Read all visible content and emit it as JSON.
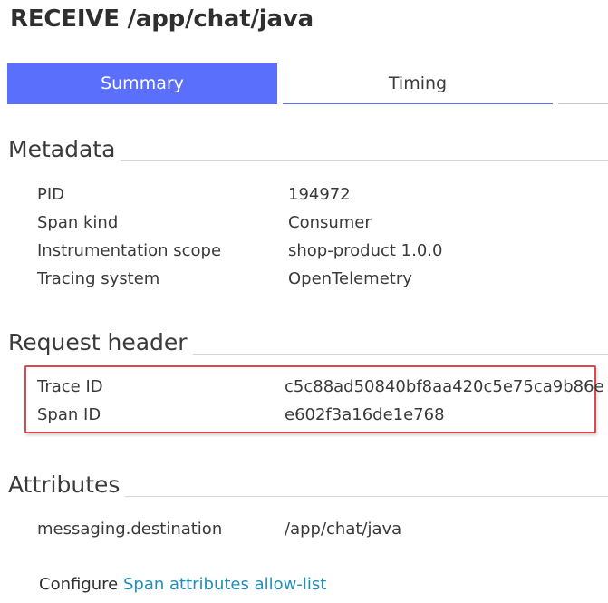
{
  "header": {
    "title": "RECEIVE /app/chat/java"
  },
  "tabs": [
    {
      "label": "Summary",
      "active": true
    },
    {
      "label": "Timing",
      "active": false
    }
  ],
  "sections": {
    "metadata": {
      "title": "Metadata",
      "rows": [
        {
          "key": "PID",
          "value": "194972"
        },
        {
          "key": "Span kind",
          "value": "Consumer"
        },
        {
          "key": "Instrumentation scope",
          "value": "shop-product 1.0.0"
        },
        {
          "key": "Tracing system",
          "value": "OpenTelemetry"
        }
      ]
    },
    "request_header": {
      "title": "Request header",
      "rows": [
        {
          "key": "Trace ID",
          "value": "c5c88ad50840bf8aa420c5e75ca9b86e"
        },
        {
          "key": "Span ID",
          "value": "e602f3a16de1e768"
        }
      ]
    },
    "attributes": {
      "title": "Attributes",
      "rows": [
        {
          "key": "messaging.destination",
          "value": "/app/chat/java"
        }
      ]
    }
  },
  "footer": {
    "configure_label": "Configure",
    "link_label": "Span attributes allow-list"
  },
  "colors": {
    "accent": "#5a6ffb",
    "highlight_border": "#e0464c",
    "link": "#1f8fb5"
  }
}
